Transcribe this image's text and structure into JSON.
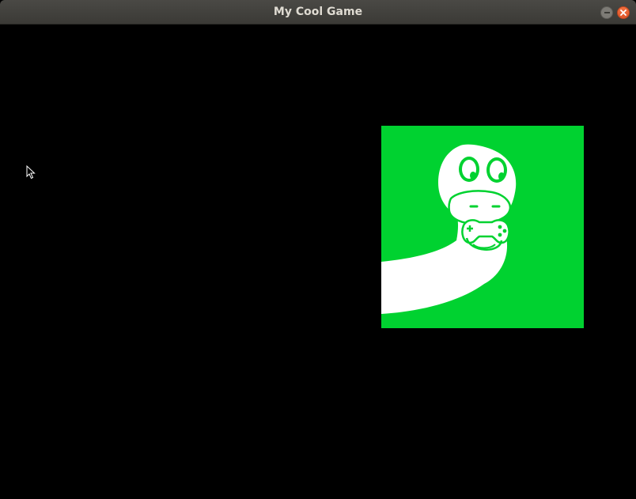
{
  "window": {
    "title": "My Cool Game",
    "minimize_icon": "minimize-icon",
    "close_icon": "close-icon"
  },
  "game": {
    "background_color": "#000000",
    "sprite": {
      "icon": "snake-mascot-icon",
      "background_color": "#00d230",
      "figure_color": "#ffffff"
    }
  },
  "cursor": {
    "icon": "arrow-cursor-icon"
  }
}
